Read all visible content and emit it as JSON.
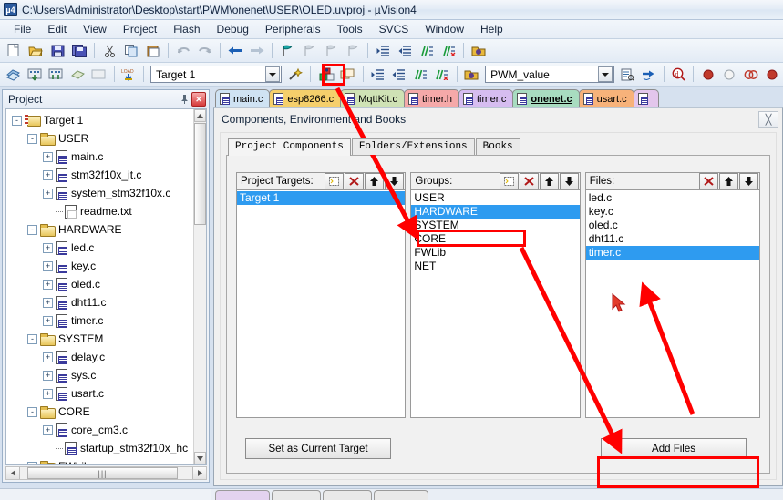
{
  "window": {
    "title": "C:\\Users\\Administrator\\Desktop\\start\\PWM\\onenet\\USER\\OLED.uvproj - µVision4",
    "app_icon": "uvision-logo-icon"
  },
  "menu": {
    "items": [
      "File",
      "Edit",
      "View",
      "Project",
      "Flash",
      "Debug",
      "Peripherals",
      "Tools",
      "SVCS",
      "Window",
      "Help"
    ]
  },
  "toolbar_top": {
    "icons": [
      "new-file-icon",
      "open-file-icon",
      "save-icon",
      "save-all-icon",
      "cut-icon",
      "copy-icon",
      "paste-icon",
      "undo-icon",
      "redo-icon",
      "back-icon",
      "forward-icon",
      "bookmark-toggle-icon",
      "bookmark-prev-icon",
      "bookmark-next-icon",
      "bookmark-clear-icon",
      "indent-icon",
      "outdent-icon",
      "comment-icon",
      "uncomment-icon",
      "open-folder-icon"
    ]
  },
  "toolbar_second": {
    "icons": [
      "translate-icon",
      "build-icon",
      "rebuild-icon",
      "batch-build-icon",
      "stop-build-icon",
      "load-icon"
    ],
    "target_select": {
      "value": "Target 1",
      "dropdown_icon": "chevron-down-icon"
    },
    "wizard_icon": "magic-wand-icon",
    "manage_components_icon": "manage-project-components-icon",
    "manage_multi_icon": "manage-multi-project-icon",
    "find_field": {
      "value": "PWM_value",
      "dropdown_icon": "chevron-down-icon"
    },
    "right_icons": [
      "find-in-files-icon",
      "goto-definition-icon",
      "debug-query-icon",
      "breakpoint-insert-icon",
      "breakpoint-disable-icon",
      "breakpoint-disable-all-icon",
      "breakpoint-kill-icon"
    ]
  },
  "project_panel": {
    "title": "Project",
    "pin_icon": "pin-icon",
    "close_icon": "close-icon",
    "tree": [
      {
        "label": "Target 1",
        "icon": "target-icon",
        "level": 0,
        "expander": "-"
      },
      {
        "label": "USER",
        "icon": "folder-icon",
        "level": 1,
        "expander": "-"
      },
      {
        "label": "main.c",
        "icon": "c-file-icon",
        "level": 2,
        "expander": "+"
      },
      {
        "label": "stm32f10x_it.c",
        "icon": "c-file-icon",
        "level": 2,
        "expander": "+"
      },
      {
        "label": "system_stm32f10x.c",
        "icon": "c-file-icon",
        "level": 2,
        "expander": "+"
      },
      {
        "label": "readme.txt",
        "icon": "text-file-icon",
        "level": 2,
        "expander": ""
      },
      {
        "label": "HARDWARE",
        "icon": "folder-icon",
        "level": 1,
        "expander": "-"
      },
      {
        "label": "led.c",
        "icon": "c-file-icon",
        "level": 2,
        "expander": "+"
      },
      {
        "label": "key.c",
        "icon": "c-file-icon",
        "level": 2,
        "expander": "+"
      },
      {
        "label": "oled.c",
        "icon": "c-file-icon",
        "level": 2,
        "expander": "+"
      },
      {
        "label": "dht11.c",
        "icon": "c-file-icon",
        "level": 2,
        "expander": "+"
      },
      {
        "label": "timer.c",
        "icon": "c-file-icon",
        "level": 2,
        "expander": "+"
      },
      {
        "label": "SYSTEM",
        "icon": "folder-icon",
        "level": 1,
        "expander": "-"
      },
      {
        "label": "delay.c",
        "icon": "c-file-icon",
        "level": 2,
        "expander": "+"
      },
      {
        "label": "sys.c",
        "icon": "c-file-icon",
        "level": 2,
        "expander": "+"
      },
      {
        "label": "usart.c",
        "icon": "c-file-icon",
        "level": 2,
        "expander": "+"
      },
      {
        "label": "CORE",
        "icon": "folder-icon",
        "level": 1,
        "expander": "-"
      },
      {
        "label": "core_cm3.c",
        "icon": "c-file-icon",
        "level": 2,
        "expander": "+"
      },
      {
        "label": "startup_stm32f10x_hc",
        "icon": "c-file-icon",
        "level": 2,
        "expander": ""
      },
      {
        "label": "FWLib",
        "icon": "folder-icon",
        "level": 1,
        "expander": "-"
      }
    ]
  },
  "editor_tabs": [
    {
      "label": "main.c",
      "color": "#cfe2f3",
      "active": false
    },
    {
      "label": "esp8266.c",
      "color": "#f5cf6b",
      "active": false
    },
    {
      "label": "MqttKit.c",
      "color": "#cfe2b5",
      "active": false
    },
    {
      "label": "timer.h",
      "color": "#f5a9a9",
      "active": false
    },
    {
      "label": "timer.c",
      "color": "#d6bdf0",
      "active": false
    },
    {
      "label": "onenet.c",
      "color": "#a8dcc0",
      "active": true
    },
    {
      "label": "usart.c",
      "color": "#f7b27a",
      "active": false
    },
    {
      "label": "",
      "color": "#e3c6ec",
      "active": false
    }
  ],
  "dialog": {
    "title": "Components, Environment and Books",
    "close_icon": "close-icon",
    "tabs": [
      {
        "label": "Project Components",
        "active": true
      },
      {
        "label": "Folders/Extensions",
        "active": false
      },
      {
        "label": "Books",
        "active": false
      }
    ],
    "project_targets": {
      "label": "Project Targets:",
      "buttons": [
        "new-item-icon",
        "delete-item-icon",
        "move-up-icon",
        "move-down-icon"
      ],
      "items": [
        {
          "label": "Target 1",
          "selected": true
        }
      ]
    },
    "groups": {
      "label": "Groups:",
      "buttons": [
        "new-item-icon",
        "delete-item-icon",
        "move-up-icon",
        "move-down-icon"
      ],
      "items": [
        {
          "label": "USER",
          "selected": false
        },
        {
          "label": "HARDWARE",
          "selected": true
        },
        {
          "label": "SYSTEM",
          "selected": false
        },
        {
          "label": "CORE",
          "selected": false
        },
        {
          "label": "FWLib",
          "selected": false
        },
        {
          "label": "NET",
          "selected": false
        }
      ]
    },
    "files": {
      "label": "Files:",
      "buttons": [
        "delete-item-icon",
        "move-up-icon",
        "move-down-icon"
      ],
      "items": [
        {
          "label": "led.c",
          "selected": false
        },
        {
          "label": "key.c",
          "selected": false
        },
        {
          "label": "oled.c",
          "selected": false
        },
        {
          "label": "dht11.c",
          "selected": false
        },
        {
          "label": "timer.c",
          "selected": true
        }
      ]
    },
    "buttons": {
      "set_current": "Set as Current Target",
      "add_files": "Add Files"
    }
  },
  "annotations": {
    "highlight_color": "#ff0000",
    "boxes": [
      "manage-components-toolbar-button",
      "hardware-group-row",
      "add-files-button"
    ],
    "arrows": [
      "toolbar-button-to-hardware-group",
      "hardware-group-to-add-files",
      "add-files-to-timer-c"
    ]
  }
}
